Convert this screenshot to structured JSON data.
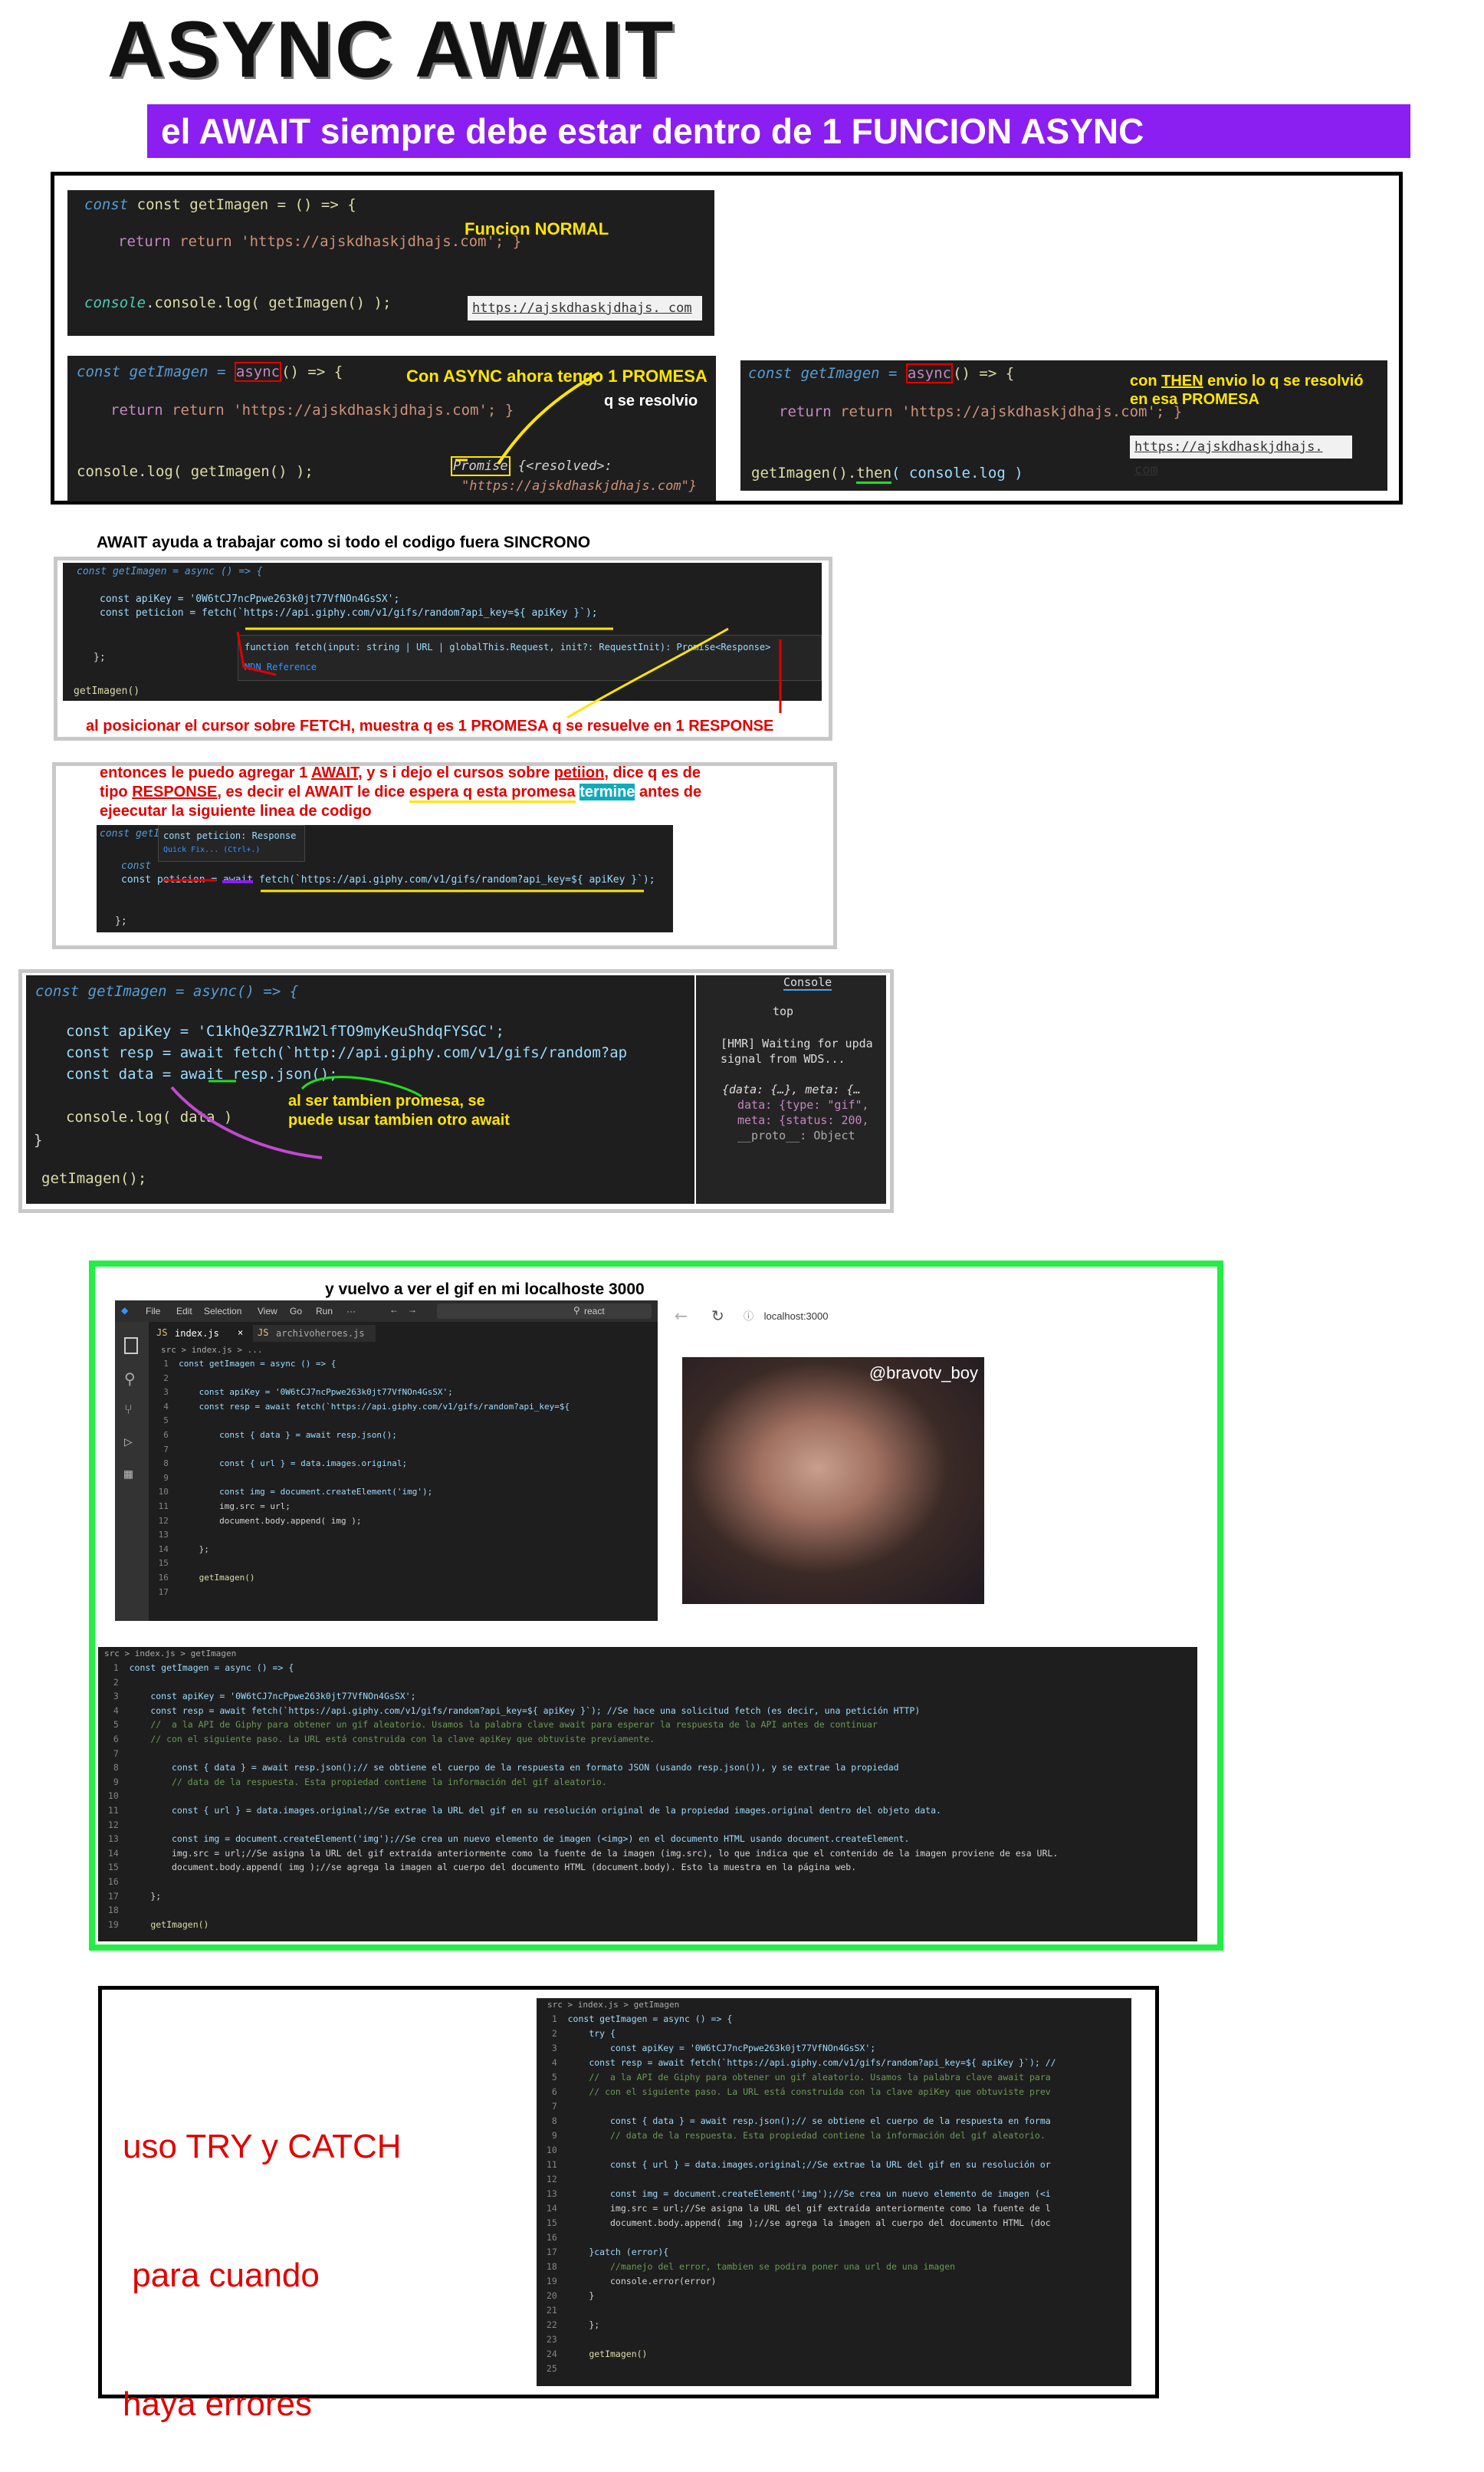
{
  "title": "ASYNC AWAIT",
  "banner": "el AWAIT siempre debe estar dentro de 1 FUNCION ASYNC",
  "section1": {
    "normal": {
      "l1": "const getImagen = () => {",
      "l2": "return 'https://ajskdhaskjdhajs.com'; }",
      "l3": "console.log( getImagen() );",
      "output": "https://ajskdhaskjdhajs. com",
      "note": "Funcion NORMAL"
    },
    "async": {
      "l1a": "const getImagen = ",
      "l1b": "async",
      "l1c": "() => {",
      "l2": "return 'https://ajskdhaskjdhajs.com'; }",
      "l3": "console.log( getImagen() );",
      "promise_word": "Promise",
      "promise_rest": " {<resolved>:",
      "promise_val": "\"https://ajskdhaskjdhajs.com\"}",
      "note1": "Con ASYNC ahora tengo 1 PROMESA",
      "note2": "q se resolvio"
    },
    "then": {
      "l1a": "const getImagen = ",
      "l1b": "async",
      "l1c": "() => {",
      "l2": "return 'https://ajskdhaskjdhajs.com'; }",
      "l3a": "getImagen().",
      "l3b": "then",
      "l3c": "( console.log )",
      "output": "https://ajskdhaskjdhajs. com",
      "note1a": "con ",
      "note1b": "THEN",
      "note1c": " envio lo q se resolvió",
      "note2": "en esa PROMESA"
    }
  },
  "section2": {
    "heading": "AWAIT ayuda a trabajar como si todo el codigo fuera SINCRONO",
    "l1": "const getImagen = async () => {",
    "l2": "const apiKey = '0W6tCJ7ncPpwe263k0jt77VfNOn4GsSX';",
    "l3": "const peticion = fetch(`https://api.giphy.com/v1/gifs/random?api_key=${ apiKey }`);",
    "l4": "};",
    "l5": "getImagen()",
    "tooltip": "function fetch(input: string | URL | globalThis.Request, init?: RequestInit): Promise<Response>",
    "tooltip_link": "MDN Reference",
    "note": "al posicionar el cursor sobre FETCH, muestra q es 1 PROMESA q se resuelve en 1 RESPONSE"
  },
  "section3": {
    "p1a": "entonces le puedo agregar 1 ",
    "p1b": "AWAIT",
    "p1c": ", y s i dejo el cursos sobre ",
    "p1d": "petiion",
    "p1e": ", dice q es de",
    "p2a": "tipo ",
    "p2b": "RESPONSE",
    "p2c": ", es decir el AWAIT le dice ",
    "p2d": "espera q esta promesa",
    "p2e": "termine",
    "p2f": " antes de",
    "p3": "ejeecutar la siguiente linea de codigo",
    "tt1": "const peticion: Response",
    "tt2": "Quick Fix... (Ctrl+.)",
    "l1": "const getI",
    "l2": "const",
    "l3": "const peticion = await fetch(`https://api.giphy.com/v1/gifs/random?api_key=${ apiKey }`);",
    "l4": "};"
  },
  "section4": {
    "l1": "const getImagen = async() => {",
    "l2": "const apiKey = 'C1khQe3Z7R1W2lfTO9myKeuShdqFYSGC';",
    "l3": "const resp = await fetch(`http://api.giphy.com/v1/gifs/random?ap",
    "l4": "const data = await resp.json();",
    "l5": "console.log( data )",
    "l6": "}",
    "l7": "getImagen();",
    "note1": "al ser tambien promesa, se",
    "note2": "puede usar tambien otro await",
    "console_tab": "Console",
    "console_top": "top",
    "c1": "[HMR] Waiting for upda",
    "c2": "signal from WDS...",
    "c3": "{data: {…}, meta: {…",
    "c4": "data: {type: \"gif\",",
    "c5": "meta: {status: 200,",
    "c6": "__proto__: Object"
  },
  "section5": {
    "heading": "y vuelvo a ver el gif en mi localhoste 3000",
    "menu": [
      "File",
      "Edit",
      "Selection",
      "View",
      "Go",
      "Run",
      "···"
    ],
    "search": "react",
    "tab1": "index.js",
    "tab2": "archivoheroes.js",
    "crumb": "src > index.js > ...",
    "code": [
      "const getImagen = async () => {",
      "",
      "    const apiKey = '0W6tCJ7ncPpwe263k0jt77VfNOn4GsSX';",
      "    const resp = await fetch(`https://api.giphy.com/v1/gifs/random?api_key=${",
      "",
      "        const { data } = await resp.json();",
      "",
      "        const { url } = data.images.original;",
      "",
      "        const img = document.createElement('img');",
      "        img.src = url;",
      "        document.body.append( img );",
      "",
      "    };",
      "",
      "    getImagen()",
      ""
    ],
    "browser_url": "localhost:3000",
    "gif_watermark": "@bravotv_boy",
    "code2_crumb": "src > index.js > getImagen",
    "code2": [
      "const getImagen = async () => {",
      "",
      "    const apiKey = '0W6tCJ7ncPpwe263k0jt77VfNOn4GsSX';",
      "    const resp = await fetch(`https://api.giphy.com/v1/gifs/random?api_key=${ apiKey }`); //Se hace una solicitud fetch (es decir, una petición HTTP)",
      "    //  a la API de Giphy para obtener un gif aleatorio. Usamos la palabra clave await para esperar la respuesta de la API antes de continuar",
      "    // con el siguiente paso. La URL está construida con la clave apiKey que obtuviste previamente.",
      "",
      "        const { data } = await resp.json();// se obtiene el cuerpo de la respuesta en formato JSON (usando resp.json()), y se extrae la propiedad",
      "        // data de la respuesta. Esta propiedad contiene la información del gif aleatorio.",
      "",
      "        const { url } = data.images.original;//Se extrae la URL del gif en su resolución original de la propiedad images.original dentro del objeto data.",
      "",
      "        const img = document.createElement('img');//Se crea un nuevo elemento de imagen (<img>) en el documento HTML usando document.createElement.",
      "        img.src = url;//Se asigna la URL del gif extraída anteriormente como la fuente de la imagen (img.src), lo que indica que el contenido de la imagen proviene de esa URL.",
      "        document.body.append( img );//se agrega la imagen al cuerpo del documento HTML (document.body). Esto la muestra en la página web.",
      "",
      "    };",
      "",
      "    getImagen()"
    ]
  },
  "section6": {
    "t1": "uso TRY y CATCH",
    "t2": " para cuando",
    "t3": "haya errores",
    "crumb": "src > index.js > getImagen",
    "code": [
      "const getImagen = async () => {",
      "    try {",
      "        const apiKey = '0W6tCJ7ncPpwe263k0jt77VfNOn4GsSX';",
      "    const resp = await fetch(`https://api.giphy.com/v1/gifs/random?api_key=${ apiKey }`); //",
      "    //  a la API de Giphy para obtener un gif aleatorio. Usamos la palabra clave await para",
      "    // con el siguiente paso. La URL está construida con la clave apiKey que obtuviste prev",
      "",
      "        const { data } = await resp.json();// se obtiene el cuerpo de la respuesta en forma",
      "        // data de la respuesta. Esta propiedad contiene la información del gif aleatorio.",
      "",
      "        const { url } = data.images.original;//Se extrae la URL del gif en su resolución or",
      "",
      "        const img = document.createElement('img');//Se crea un nuevo elemento de imagen (<i",
      "        img.src = url;//Se asigna la URL del gif extraída anteriormente como la fuente de l",
      "        document.body.append( img );//se agrega la imagen al cuerpo del documento HTML (doc",
      "",
      "    }catch (error){",
      "        //manejo del error, tambien se podira poner una url de una imagen",
      "        console.error(error)",
      "    }",
      "",
      "    };",
      "",
      "    getImagen()",
      ""
    ]
  }
}
